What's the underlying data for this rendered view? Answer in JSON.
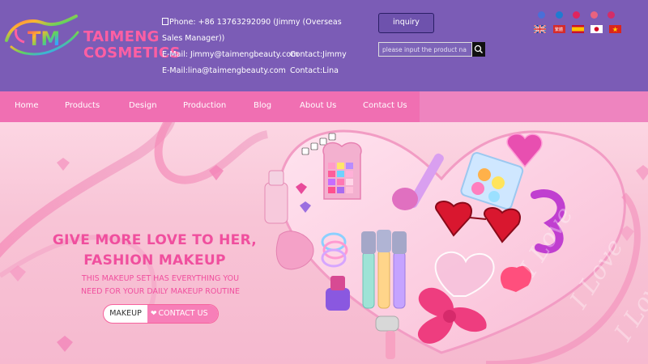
{
  "brand": {
    "line1": "TAIMENG",
    "line2": "COSMETICS",
    "mark_text": "TM"
  },
  "contact": {
    "phone": "Phone: +86 13763292090 (Jimmy (Overseas Sales Manager))",
    "email1": "E-Mail: Jimmy@taimengbeauty.com",
    "contact1": "Contact:Jimmy",
    "email2": "E-Mail:lina@taimengbeauty.com",
    "contact2": "Contact:Lina"
  },
  "header": {
    "inquiry_label": "inquiry",
    "search_placeholder": "please input the product na"
  },
  "social": [
    "facebook-icon",
    "linkedin-icon",
    "pinterest-icon",
    "youtube-icon",
    "instagram-icon"
  ],
  "languages": [
    "English",
    "Chinese Traditional",
    "Spanish",
    "Japanese",
    "Vietnamese"
  ],
  "nav": {
    "items": [
      "Home",
      "Products",
      "Design",
      "Production",
      "Blog",
      "About Us",
      "Contact Us"
    ]
  },
  "hero": {
    "headline_line1": "GIVE MORE LOVE TO HER,",
    "headline_line2": "FASHION MAKEUP",
    "sub_line1": "THIS MAKEUP SET HAS EVERYTHING YOU",
    "sub_line2": "NEED FOR YOUR DAILY MAKEUP ROUTINE",
    "cta_left": "MAKEUP",
    "cta_right": "CONTACT US",
    "decor_text": "I Love"
  },
  "colors": {
    "header_bg": "#7b5cb6",
    "nav_bg": "#f06fb2",
    "brand_pink": "#ff5fa3",
    "headline": "#f04f9e"
  }
}
